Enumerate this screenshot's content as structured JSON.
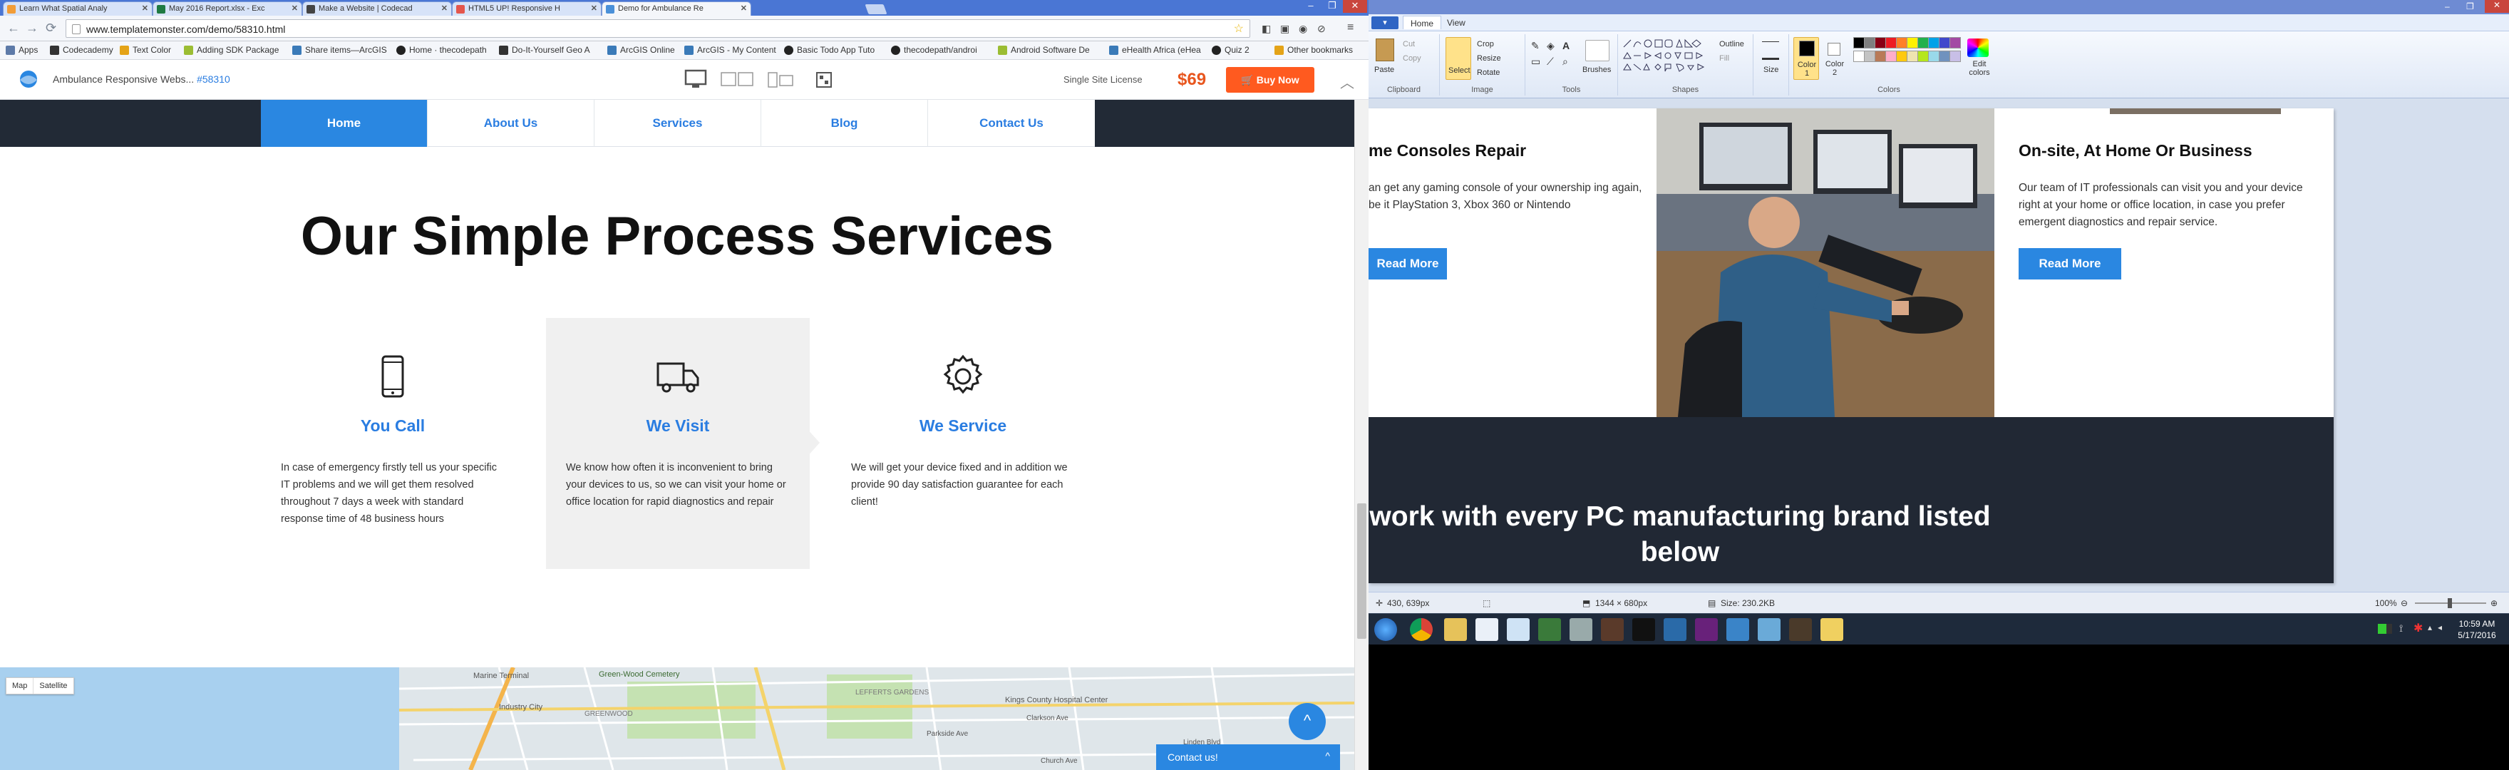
{
  "browser": {
    "tabs": [
      {
        "label": "Learn What Spatial Analy",
        "fav": "#f29d38"
      },
      {
        "label": "May 2016 Report.xlsx - Exc",
        "fav": "#1f7a43"
      },
      {
        "label": "Make a Website | Codecad",
        "fav": "#444444"
      },
      {
        "label": "HTML5 UP! Responsive H",
        "fav": "#e4564c"
      },
      {
        "label": "Demo for Ambulance Re",
        "fav": "#4a90d9"
      }
    ],
    "window_buttons": [
      "–",
      "❐",
      "✕"
    ],
    "url": "www.templatemonster.com/demo/58310.html",
    "bookmarks": [
      {
        "label": "Apps",
        "color": "#5d7aa8"
      },
      {
        "label": "Codecademy",
        "color": "#333333"
      },
      {
        "label": "Text Color",
        "color": "#e4a317"
      },
      {
        "label": "Adding SDK Package",
        "color": "#9bbd33"
      },
      {
        "label": "Share items—ArcGIS",
        "color": "#3a7ab8"
      },
      {
        "label": "Home · thecodepath",
        "color": "#222222"
      },
      {
        "label": "Do-It-Yourself Geo A",
        "color": "#333333"
      },
      {
        "label": "ArcGIS Online",
        "color": "#3a7ab8"
      },
      {
        "label": "ArcGIS - My Content",
        "color": "#3a7ab8"
      },
      {
        "label": "Basic Todo App Tuto",
        "color": "#222222"
      },
      {
        "label": "thecodepath/androi",
        "color": "#222222"
      },
      {
        "label": "Android Software De",
        "color": "#9bbd33"
      },
      {
        "label": "eHealth Africa (eHea",
        "color": "#3a7ab8"
      },
      {
        "label": "Quiz 2",
        "color": "#222222"
      },
      {
        "label": "Other bookmarks",
        "color": "#e4a317"
      }
    ]
  },
  "templatemonster": {
    "title": "Ambulance Responsive Webs...",
    "template_id": "#58310",
    "license": "Single Site License",
    "price": "$69",
    "buy_label": "Buy Now",
    "collapse_icon": "chevron-up-icon"
  },
  "site": {
    "nav": [
      {
        "label": "Home",
        "active": true
      },
      {
        "label": "About Us",
        "active": false
      },
      {
        "label": "Services",
        "active": false
      },
      {
        "label": "Blog",
        "active": false
      },
      {
        "label": "Contact Us",
        "active": false
      }
    ],
    "process_title": "Our Simple Process Services",
    "cards": [
      {
        "icon": "tablet-icon",
        "title": "You Call",
        "text": "In case of emergency firstly tell us your specific IT problems and we will get them resolved throughout 7 days a week with standard response time of 48 business hours"
      },
      {
        "icon": "truck-icon",
        "title": "We Visit",
        "text": "We know how often it is inconvenient to bring your devices to us, so we can visit your home or office location for rapid diagnostics and repair"
      },
      {
        "icon": "gear-icon",
        "title": "We Service",
        "text": "We will get your device fixed and in addition we provide 90 day satisfaction guarantee for each client!"
      }
    ],
    "map": {
      "types": [
        "Map",
        "Satellite"
      ],
      "labels": [
        "Marine Terminal",
        "Green-Wood Cemetery",
        "Industry City",
        "GREENWOOD",
        "Kings County Hospital Center",
        "Clarkson Ave",
        "Church Ave",
        "Linden Blvd",
        "LEFFERTS GARDENS",
        "Parkside Ave"
      ]
    },
    "scroll_top_icon": "chevron-up-icon",
    "contact_label": "Contact us!",
    "contact_toggle": "^"
  },
  "paint": {
    "tabs": [
      "Home",
      "View"
    ],
    "file_label": "▾",
    "groups": {
      "clipboard": "Clipboard",
      "image": "Image",
      "tools": "Tools",
      "shapes": "Shapes",
      "colors": "Colors"
    },
    "buttons": {
      "paste": "Paste",
      "cut": "Cut",
      "copy": "Copy",
      "select": "Select",
      "crop": "Crop",
      "resize": "Resize",
      "rotate": "Rotate",
      "brushes": "Brushes",
      "outline": "Outline",
      "fill": "Fill",
      "size": "Size",
      "color1": "Color 1",
      "color2": "Color 2",
      "edit_colors": "Edit colors"
    },
    "palette": [
      "#000000",
      "#7f7f7f",
      "#880015",
      "#ed1c24",
      "#ff7f27",
      "#fff200",
      "#22b14c",
      "#00a2e8",
      "#3f48cc",
      "#a349a4",
      "#ffffff",
      "#c3c3c3",
      "#b97a57",
      "#ffaec9",
      "#ffc90e",
      "#efe4b0",
      "#b5e61d",
      "#99d9ea",
      "#7092be",
      "#c8bfe7"
    ],
    "canvas": {
      "left_heading": "me Consoles Repair",
      "left_text": "an get any gaming console of your ownership ing again, be it PlayStation 3, Xbox 360 or Nintendo",
      "left_button": "Read More",
      "right_heading": "On-site, At Home Or Business",
      "right_text": "Our team of IT professionals can visit you and your device right at your home or office location, in case you prefer emergent diagnostics and repair service.",
      "right_button": "Read More",
      "band_heading": "work with every PC manufacturing brand listed below"
    },
    "status": {
      "cursor": "430, 639px",
      "selection": "1344 × 680px",
      "size": "Size: 230.2KB",
      "zoom": "100%"
    }
  },
  "taskbar": {
    "time": "10:59 AM",
    "date": "5/17/2016",
    "icons": [
      "windows-start-icon",
      "chrome-icon",
      "file-explorer-icon",
      "notepad-icon",
      "document-icon",
      "app-icon",
      "settings-icon",
      "media-icon",
      "terminal-icon",
      "network-icon",
      "visual-studio-icon",
      "sublime-icon",
      "paint-icon",
      "image-viewer-icon",
      "folder-icon"
    ]
  }
}
